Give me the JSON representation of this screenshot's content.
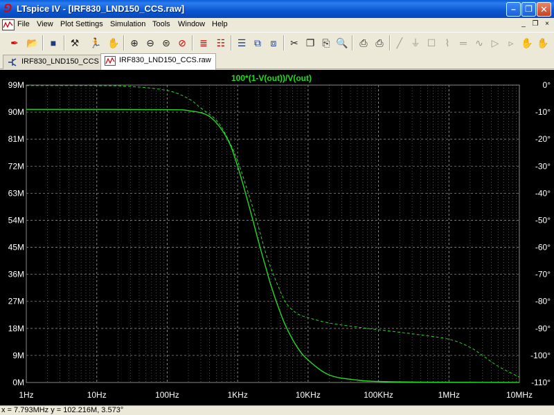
{
  "window": {
    "title": "LTspice IV - [IRF830_LND150_CCS.raw]",
    "minimize_glyph": "–",
    "maximize_glyph": "❐",
    "close_glyph": "✕"
  },
  "menu": {
    "items": [
      "File",
      "View",
      "Plot Settings",
      "Simulation",
      "Tools",
      "Window",
      "Help"
    ],
    "mdi_minimize": "_",
    "mdi_restore": "❐",
    "mdi_close": "×"
  },
  "toolbar": {
    "icons": [
      "open-icon",
      "open-folder-icon",
      "save-icon",
      "control-panel-icon",
      "run-icon",
      "pan-hand-icon",
      "zoom-in-icon",
      "zoom-out-icon",
      "zoom-fit-icon",
      "zoom-cancel-icon",
      "autorange-icon",
      "mark-unmark-icon",
      "tile-horizontal-icon",
      "cascade-icon",
      "tile-icon",
      "cut-icon",
      "copy-icon",
      "find-icon",
      "print-preview-icon",
      "print-icon",
      "wire-icon",
      "ground-icon",
      "label-icon",
      "resistor-icon",
      "capacitor-icon",
      "inductor-icon",
      "diode-icon",
      "component-icon",
      "move-icon",
      "drag-icon"
    ]
  },
  "tabs": [
    {
      "label": "IRF830_LND150_CCS",
      "active": false
    },
    {
      "label": "IRF830_LND150_CCS.raw",
      "active": true
    }
  ],
  "status": {
    "cursor_readout": "x = 7.793MHz    y = 102.216M, 3.573°"
  },
  "colors": {
    "plot_background": "#000000",
    "trace": "#22dd22",
    "grid": "#8a8a8a",
    "axis_text": "#ffffff"
  },
  "chart_data": {
    "type": "line",
    "title": "100*(1-V(out))/V(out)",
    "xscale": "log",
    "xlim": [
      1,
      10000000
    ],
    "x_tick_labels": [
      "1Hz",
      "10Hz",
      "100Hz",
      "1KHz",
      "10KHz",
      "100KHz",
      "1MHz",
      "10MHz"
    ],
    "x_tick_values": [
      1,
      10,
      100,
      1000,
      10000,
      100000,
      1000000,
      10000000
    ],
    "ylim_left": [
      0,
      99000000
    ],
    "y_left_tick_labels": [
      "99M",
      "90M",
      "81M",
      "72M",
      "63M",
      "54M",
      "45M",
      "36M",
      "27M",
      "18M",
      "9M",
      "0M"
    ],
    "y_left_tick_values": [
      99000000,
      90000000,
      81000000,
      72000000,
      63000000,
      54000000,
      45000000,
      36000000,
      27000000,
      18000000,
      9000000,
      0
    ],
    "ylim_right": [
      -110,
      0
    ],
    "y_right_tick_labels": [
      "0°",
      "-10°",
      "-20°",
      "-30°",
      "-40°",
      "-50°",
      "-60°",
      "-70°",
      "-80°",
      "-90°",
      "-100°",
      "-110°"
    ],
    "y_right_tick_values": [
      0,
      -10,
      -20,
      -30,
      -40,
      -50,
      -60,
      -70,
      -80,
      -90,
      -100,
      -110
    ],
    "grid": true,
    "series": [
      {
        "kind": "magnitude",
        "axis": "left",
        "line_style": "solid",
        "x": [
          1,
          10,
          100,
          200,
          400,
          700,
          1000,
          1500,
          2000,
          2500,
          3000,
          4000,
          5000,
          7000,
          10000,
          20000,
          50000,
          100000,
          300000,
          1000000,
          3000000,
          10000000
        ],
        "y": [
          90900000,
          90900000,
          90800000,
          90500000,
          88500000,
          81500000,
          72000000,
          57500000,
          46500000,
          38500000,
          32000000,
          23500000,
          18000000,
          11800000,
          7500000,
          2500000,
          800000,
          350000,
          150000,
          80000,
          40000,
          20000
        ]
      },
      {
        "kind": "phase",
        "axis": "right",
        "line_style": "dashed",
        "x": [
          1,
          10,
          30,
          100,
          200,
          300,
          500,
          700,
          1000,
          1500,
          2000,
          2500,
          3000,
          4000,
          5000,
          7000,
          10000,
          20000,
          50000,
          100000,
          300000,
          1000000,
          2000000,
          3000000,
          5000000,
          10000000
        ],
        "y": [
          -0.2,
          -0.2,
          -0.5,
          -2,
          -5,
          -8.5,
          -13,
          -19,
          -28,
          -42,
          -53,
          -62,
          -68,
          -76,
          -81,
          -84.5,
          -86,
          -88,
          -89.5,
          -90.5,
          -92,
          -94,
          -97,
          -100,
          -104,
          -108
        ]
      }
    ]
  }
}
